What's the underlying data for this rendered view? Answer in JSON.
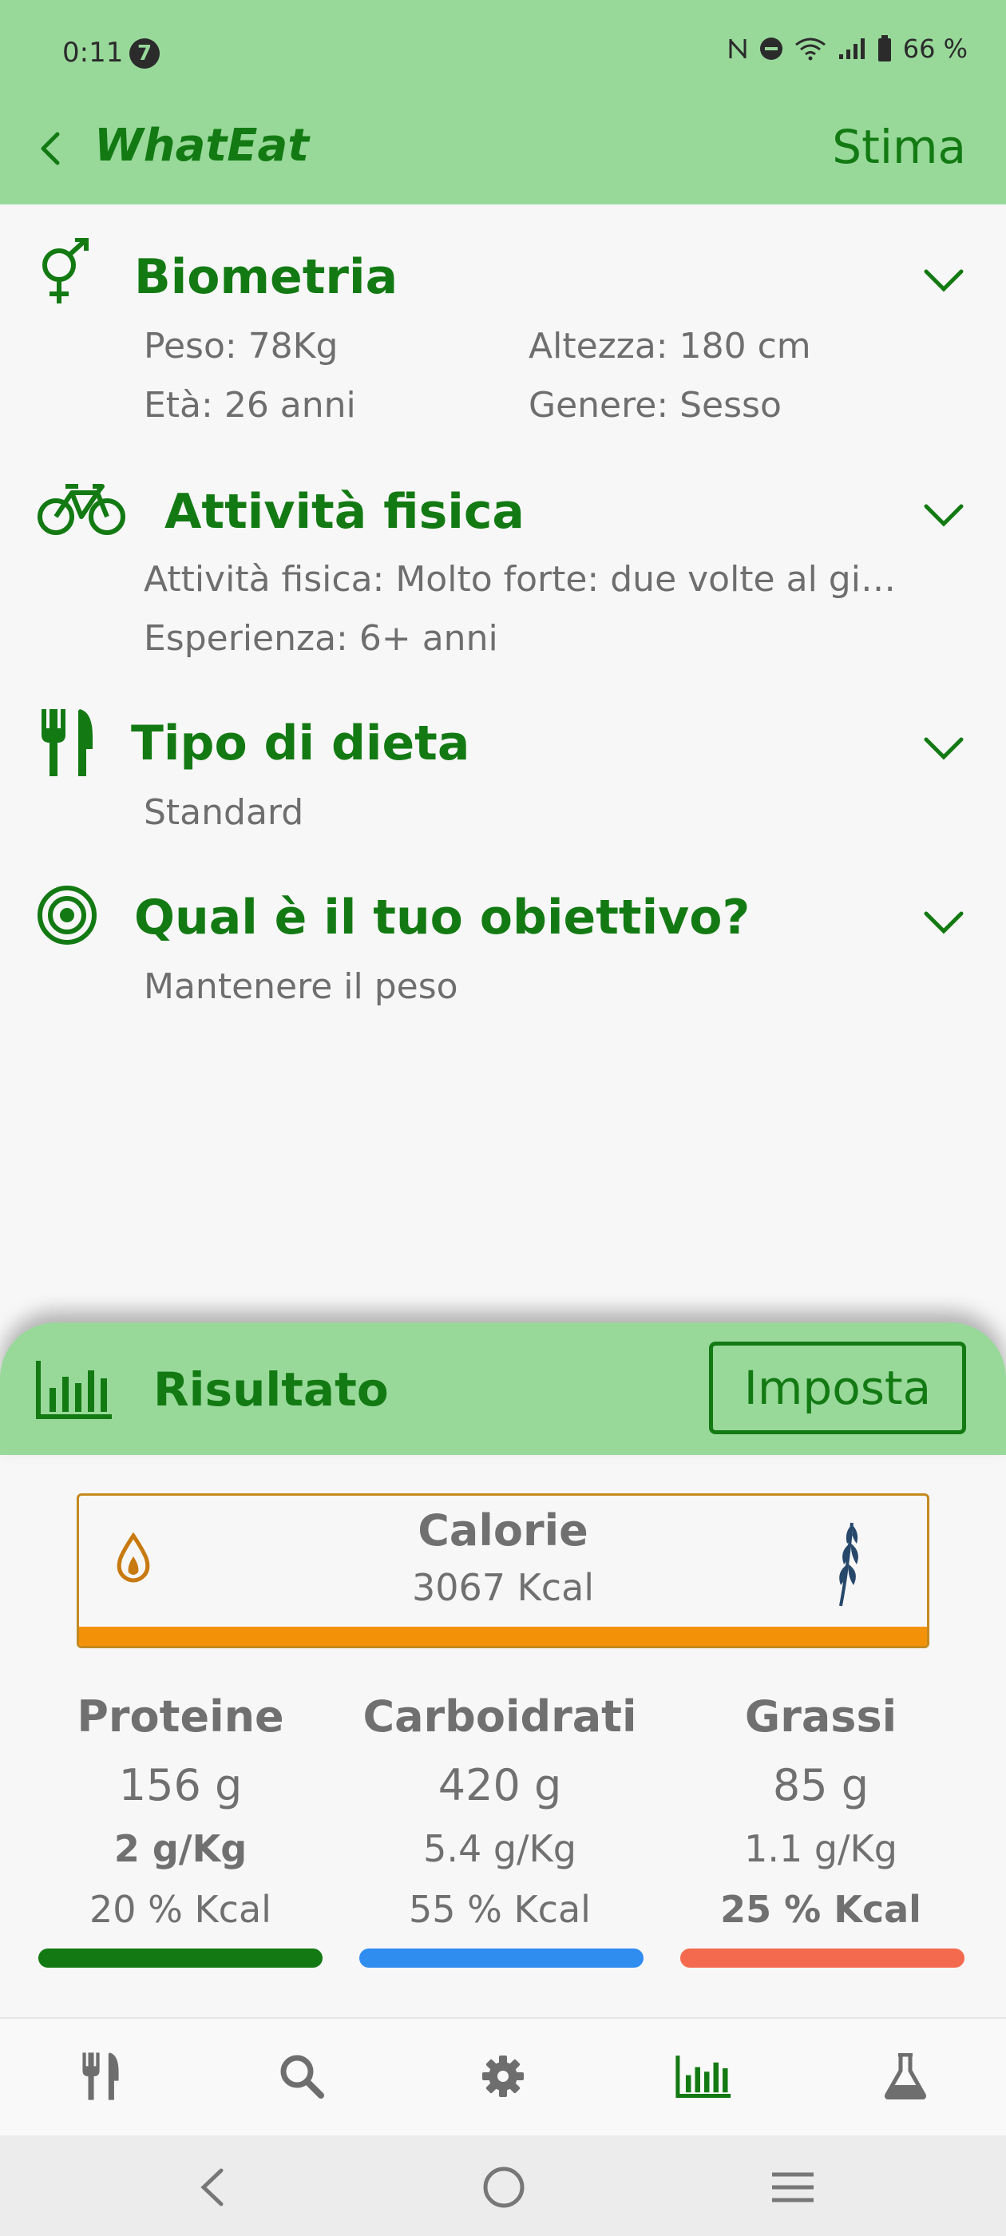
{
  "status": {
    "time": "0:11",
    "notif_count": "7",
    "battery": "66 %"
  },
  "appbar": {
    "title": "WhatEat",
    "action": "Stima"
  },
  "sections": {
    "biometria": {
      "title": "Biometria",
      "peso": "Peso: 78Kg",
      "altezza": "Altezza: 180 cm",
      "eta": "Età: 26 anni",
      "genere": "Genere: Sesso"
    },
    "attivita": {
      "title": "Attività fisica",
      "livello": "Attività fisica: Molto forte: due volte al gi…",
      "esperienza": "Esperienza: 6+ anni"
    },
    "dieta": {
      "title": "Tipo di dieta",
      "value": "Standard"
    },
    "obiettivo": {
      "title": "Qual è il tuo obiettivo?",
      "value": "Mantenere il peso"
    }
  },
  "result": {
    "title": "Risultato",
    "button": "Imposta",
    "calorie": {
      "label": "Calorie",
      "value": "3067 Kcal"
    },
    "macros": [
      {
        "name": "Proteine",
        "grams": "156 g",
        "per_kg": "2 g/Kg",
        "pct": "20 % Kcal",
        "color": "#137a13"
      },
      {
        "name": "Carboidrati",
        "grams": "420 g",
        "per_kg": "5.4 g/Kg",
        "pct": "55 % Kcal",
        "color": "#2f8df0"
      },
      {
        "name": "Grassi",
        "grams": "85 g",
        "per_kg": "1.1 g/Kg",
        "pct": "25 % Kcal",
        "color": "#f46a4e"
      }
    ]
  },
  "bottom_nav": {
    "items": [
      {
        "icon": "cutlery-icon",
        "active": false
      },
      {
        "icon": "search-icon",
        "active": false
      },
      {
        "icon": "gear-icon",
        "active": false
      },
      {
        "icon": "bar-chart-icon",
        "active": true
      },
      {
        "icon": "flask-icon",
        "active": false
      }
    ]
  },
  "colors": {
    "brand_green": "#137a13",
    "header_bg": "#98d99a",
    "calorie_orange": "#f39208"
  }
}
